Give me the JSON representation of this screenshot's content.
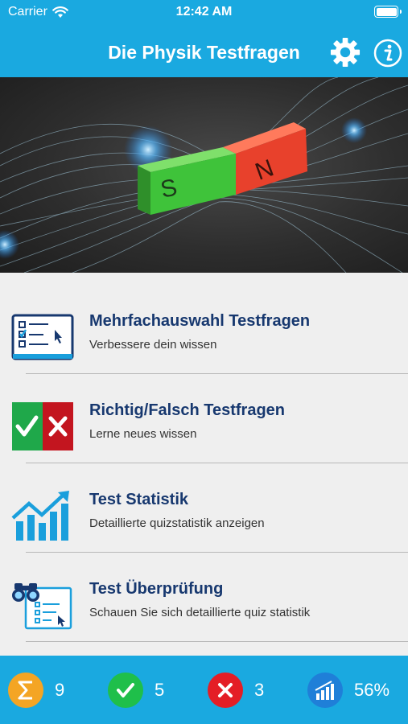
{
  "status_bar": {
    "carrier": "Carrier",
    "time": "12:42 AM"
  },
  "nav": {
    "title": "Die Physik Testfragen",
    "settings_icon": "gear-icon",
    "info_icon": "info-icon"
  },
  "hero": {
    "magnet_south": "S",
    "magnet_north": "N"
  },
  "menu": {
    "items": [
      {
        "title": "Mehrfachauswahl Testfragen",
        "subtitle": "Verbessere dein wissen",
        "icon": "multiple-choice-icon"
      },
      {
        "title": "Richtig/Falsch Testfragen",
        "subtitle": "Lerne neues wissen",
        "icon": "true-false-icon"
      },
      {
        "title": "Test Statistik",
        "subtitle": "Detaillierte quizstatistik anzeigen",
        "icon": "statistics-chart-icon"
      },
      {
        "title": "Test Überprüfung",
        "subtitle": "Schauen Sie sich detaillierte quiz statistik",
        "icon": "review-binoculars-icon"
      }
    ]
  },
  "stats": {
    "total": "9",
    "correct": "5",
    "wrong": "3",
    "percent": "56%"
  },
  "colors": {
    "primary": "#1aa9e0",
    "title_text": "#17386f",
    "total_badge": "#f4a524",
    "correct_badge": "#1fbf4a",
    "wrong_badge": "#e41e26",
    "percent_badge": "#1f7fd8"
  }
}
